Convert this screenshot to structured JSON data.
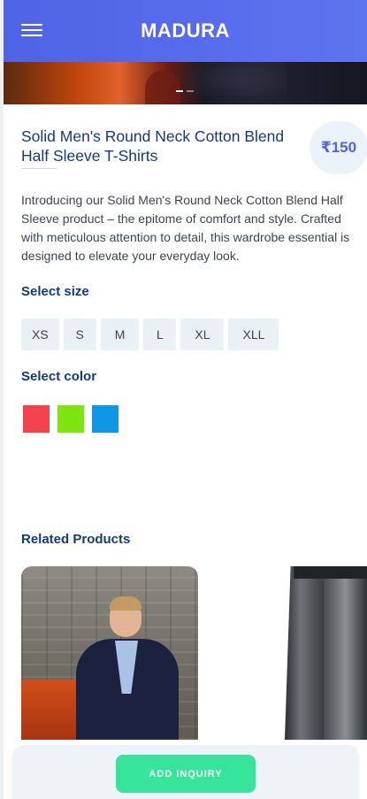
{
  "header": {
    "menu_icon": "hamburger-menu-icon",
    "brand": "MADURA",
    "gradient_colors": [
      "#4f63e6",
      "#5d74ef"
    ]
  },
  "carousel": {
    "dots": [
      {
        "active": true
      },
      {
        "active": false
      }
    ]
  },
  "product": {
    "title": "Solid Men's Round Neck Cotton Blend Half Sleeve T-Shirts",
    "price": "₹150",
    "description": "Introducing our Solid Men's Round Neck Cotton Blend Half Sleeve product – the epitome of comfort and style. Crafted with meticulous attention to detail, this wardrobe essential is designed to elevate your everyday look."
  },
  "size_section": {
    "label": "Select size",
    "options": [
      "XS",
      "S",
      "M",
      "L",
      "XL",
      "XLL"
    ]
  },
  "color_section": {
    "label": "Select color",
    "swatches": [
      "#f2434f",
      "#7de40c",
      "#0d97e6"
    ]
  },
  "related": {
    "label": "Related Products"
  },
  "footer": {
    "inquiry_label": "ADD INQUIRY",
    "button_color": "#37e49b"
  }
}
